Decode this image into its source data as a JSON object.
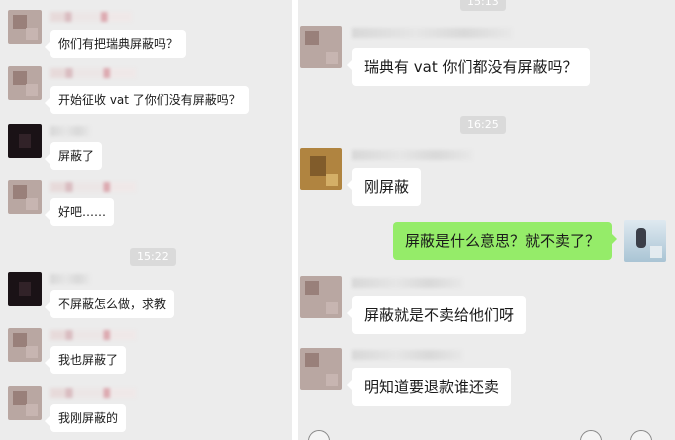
{
  "left_chat": {
    "messages": [
      "你们有把瑞典屏蔽吗？",
      "开始征收 vat 了你们没有屏蔽吗？",
      "屏蔽了",
      "好吧……",
      "不屏蔽怎么做，求教",
      "我也屏蔽了",
      "我刚屏蔽的"
    ],
    "timestamp": "15:22"
  },
  "right_chat": {
    "top_timestamp": "15:13",
    "messages": [
      "瑞典有 vat 你们都没有屏蔽吗？",
      "刚屏蔽",
      "屏蔽是什么意思？就不卖了？",
      "屏蔽就是不卖给他们呀",
      "明知道要退款谁还卖"
    ],
    "timestamp": "16:25"
  },
  "colors": {
    "chat_background": "#ececec",
    "received_bubble": "#ffffff",
    "sent_bubble": "#95ec69",
    "timestamp_chip": "#dadada"
  }
}
